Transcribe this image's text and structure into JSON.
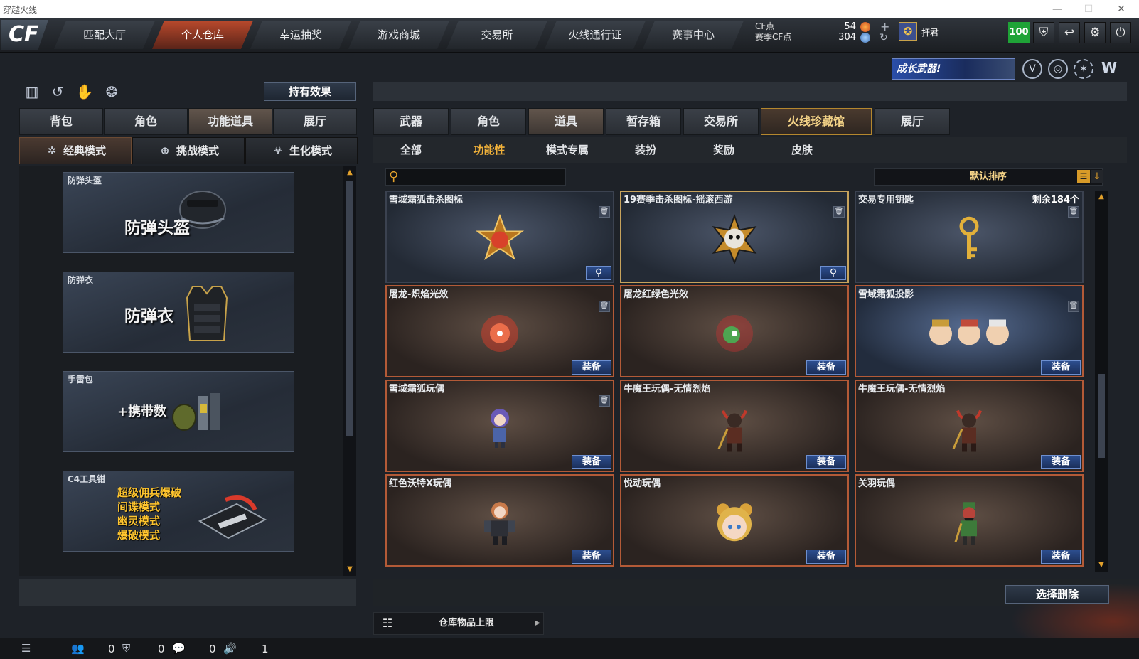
{
  "window": {
    "title": "穿越火线"
  },
  "nav": {
    "tabs": [
      "匹配大厅",
      "个人仓库",
      "幸运抽奖",
      "游戏商城",
      "交易所",
      "火线通行证",
      "赛事中心"
    ],
    "active_index": 1
  },
  "currency": {
    "cf_label": "CF点",
    "season_label": "赛季CF点",
    "cf_value": "54",
    "season_value": "304"
  },
  "user": {
    "name": "扞君",
    "level": "100"
  },
  "banner": {
    "text": "成长武器!"
  },
  "left": {
    "effect_button": "持有效果",
    "tabs": [
      "背包",
      "角色",
      "功能道具",
      "展厅"
    ],
    "active_tab": 2,
    "modes": [
      "经典模式",
      "挑战模式",
      "生化模式"
    ],
    "active_mode": 0,
    "cards": [
      {
        "name": "防弹头盔",
        "big": "防弹头盔"
      },
      {
        "name": "防弹衣",
        "big": "防弹衣"
      },
      {
        "name": "手雷包",
        "big": "+携带数"
      },
      {
        "name": "C4工具钳",
        "modes": [
          "超级佣兵爆破",
          "间谍模式",
          "幽灵模式",
          "爆破模式"
        ]
      }
    ]
  },
  "right": {
    "tabs": [
      "武器",
      "角色",
      "道具",
      "暂存箱",
      "交易所",
      "火线珍藏馆",
      "展厅"
    ],
    "active_tab": 2,
    "special_tab": 5,
    "subtabs": [
      "全部",
      "功能性",
      "模式专属",
      "装扮",
      "奖励",
      "皮肤"
    ],
    "active_subtab": 1,
    "search_placeholder": "",
    "sort_label": "默认排序",
    "equip_label": "装备",
    "items": [
      {
        "name": "雪域霜狐击杀图标",
        "extra": "",
        "has_trash": true,
        "action": "zoom"
      },
      {
        "name": "19赛季击杀图标-摇滚西游",
        "extra": "",
        "has_trash": true,
        "action": "zoom"
      },
      {
        "name": "交易专用钥匙",
        "extra": "剩余184个",
        "has_trash": true,
        "action": "none"
      },
      {
        "name": "屠龙-炽焰光效",
        "extra": "",
        "has_trash": true,
        "action": "equip"
      },
      {
        "name": "屠龙红绿色光效",
        "extra": "",
        "has_trash": false,
        "action": "equip"
      },
      {
        "name": "雪域霜狐投影",
        "extra": "",
        "has_trash": true,
        "action": "equip"
      },
      {
        "name": "雪域霜狐玩偶",
        "extra": "",
        "has_trash": true,
        "action": "equip"
      },
      {
        "name": "牛魔王玩偶-无情烈焰",
        "extra": "",
        "has_trash": false,
        "action": "equip"
      },
      {
        "name": "牛魔王玩偶-无情烈焰",
        "extra": "",
        "has_trash": false,
        "action": "equip"
      },
      {
        "name": "红色沃特X玩偶",
        "extra": "",
        "has_trash": false,
        "action": "equip"
      },
      {
        "name": "悦动玩偶",
        "extra": "",
        "has_trash": false,
        "action": "equip"
      },
      {
        "name": "关羽玩偶",
        "extra": "",
        "has_trash": false,
        "action": "equip"
      }
    ],
    "select_delete": "选择删除",
    "storage_limit": "仓库物品上限"
  },
  "status": {
    "counts": [
      "0",
      "0",
      "0",
      "1"
    ]
  },
  "colors": {
    "accent": "#e2a12c",
    "active_nav": "#b9492c",
    "level_green": "#1fa337",
    "equip_blue": "#2d4e8e"
  }
}
